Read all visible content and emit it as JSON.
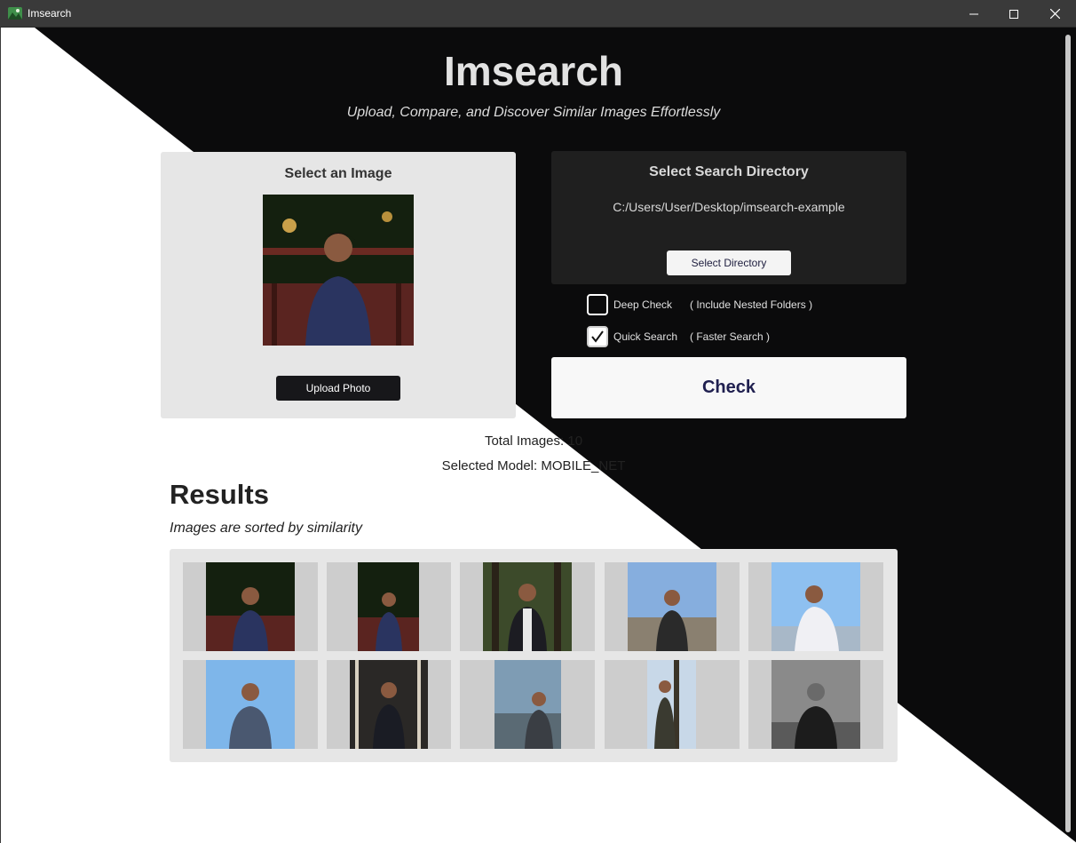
{
  "window": {
    "title": "Imsearch",
    "controls": [
      "minimize-icon",
      "maximize-icon",
      "close-icon"
    ]
  },
  "header": {
    "title": "Imsearch",
    "subtitle": "Upload, Compare, and Discover Similar Images Effortlessly"
  },
  "image_panel": {
    "heading": "Select an Image",
    "upload_label": "Upload Photo"
  },
  "directory_panel": {
    "heading": "Select Search Directory",
    "path": "C:/Users/User/Desktop/imsearch-example",
    "button_label": "Select Directory"
  },
  "options": [
    {
      "label": "Deep Check",
      "hint": "( Include Nested Folders )",
      "checked": false
    },
    {
      "label": "Quick Search",
      "hint": "( Faster Search )",
      "checked": true
    }
  ],
  "check_label": "Check",
  "stats": {
    "total_images": "Total Images: 10",
    "selected_model": "Selected Model: MOBILE_NET"
  },
  "results": {
    "title": "Results",
    "subtitle": "Images are sorted by similarity",
    "count": 10
  },
  "colors": {
    "dark_background": "#0b0b0c",
    "light_background": "#ffffff",
    "panel_light": "#e6e6e6",
    "panel_dark": "#1f1f1f",
    "button_dark": "#17171a",
    "check_text": "#202050"
  }
}
